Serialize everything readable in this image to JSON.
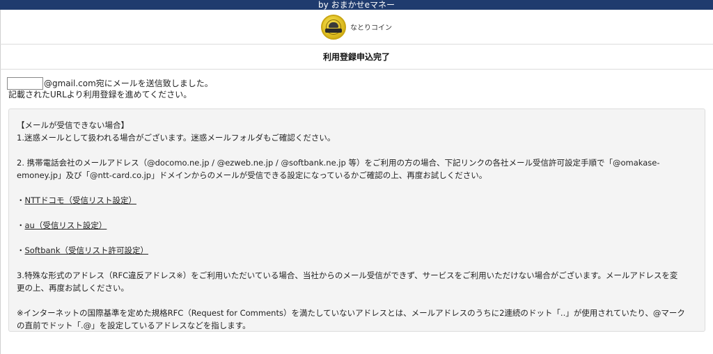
{
  "header": {
    "title": "by おまかせeマネー"
  },
  "brand": {
    "name": "なとりコイン",
    "logo_icon": "coin-logo-icon"
  },
  "page": {
    "title": "利用登録申込完了"
  },
  "message": {
    "email_value": "",
    "line1": "@gmail.com宛にメールを送信致しました。",
    "line2": "記載されたURLより利用登録を進めてください。"
  },
  "notice": {
    "heading": "【メールが受信できない場合】",
    "item1": "1.迷惑メールとして扱われる場合がございます。迷惑メールフォルダもご確認ください。",
    "item2a": "2. 携帯電話会社のメールアドレス（@docomo.ne.jp / @ezweb.ne.jp / @softbank.ne.jp 等）をご利用の方の場合、下記リンクの各社メール受信許可設定手順で「@omakase-",
    "item2b": "emoney.jp」及び「@ntt-card.co.jp」ドメインからのメールが受信できる設定になっているかご確認の上、再度お試しください。",
    "links": [
      {
        "bullet": "・",
        "label": "NTTドコモ（受信リスト設定）"
      },
      {
        "bullet": "・",
        "label": "au（受信リスト設定）"
      },
      {
        "bullet": "・",
        "label": "Softbank（受信リスト許可設定）"
      }
    ],
    "item3a": "3.特殊な形式のアドレス（RFC違反アドレス※）をご利用いただいている場合、当社からのメール受信ができず、サービスをご利用いただけない場合がございます。メールアドレスを変",
    "item3b": "更の上、再度お試しください。",
    "note_a": "※インターネットの国際基準を定めた規格RFC（Request for Comments）を満たしていないアドレスとは、メールアドレスのうちに2連続のドット「..」が使用されていたり、@マーク",
    "note_b": "の直前でドット「.@」を設定しているアドレスなどを指します。"
  }
}
